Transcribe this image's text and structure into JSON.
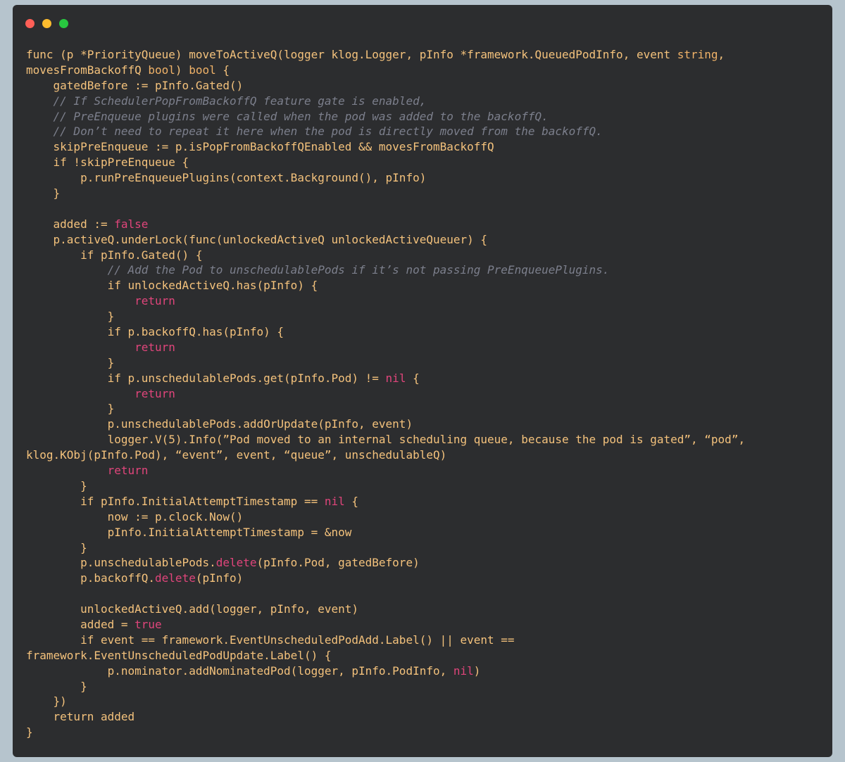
{
  "window": {
    "controls": [
      {
        "name": "close",
        "color": "#ff5f57"
      },
      {
        "name": "minimize",
        "color": "#febc2e"
      },
      {
        "name": "zoom",
        "color": "#28c840"
      }
    ]
  },
  "colors": {
    "page_background": "#b6c4cd",
    "editor_background": "#2c2d2f",
    "default": "#f4c27c",
    "literal": "#e0457b",
    "comment": "#7c7f8c",
    "punctuation": "#e8e8e8"
  },
  "code": {
    "lines": [
      [
        [
          "default",
          "func (p *PriorityQueue) moveToActiveQ(logger klog.Logger, pInfo *framework.QueuedPodInfo, event "
        ],
        [
          "type",
          "string"
        ],
        [
          "default",
          ","
        ]
      ],
      [
        [
          "default",
          "movesFromBackoffQ "
        ],
        [
          "type",
          "bool"
        ],
        [
          "default",
          ") "
        ],
        [
          "type",
          "bool"
        ],
        [
          "default",
          " {"
        ]
      ],
      [
        [
          "default",
          "    gatedBefore := pInfo.Gated()"
        ]
      ],
      [
        [
          "comment",
          "    // If SchedulerPopFromBackoffQ feature gate is enabled,"
        ]
      ],
      [
        [
          "comment",
          "    // PreEnqueue plugins were called when the pod was added to the backoffQ."
        ]
      ],
      [
        [
          "comment",
          "    // Don’t need to repeat it here when the pod is directly moved from the backoffQ."
        ]
      ],
      [
        [
          "default",
          "    skipPreEnqueue := p.isPopFromBackoffQEnabled && movesFromBackoffQ"
        ]
      ],
      [
        [
          "default",
          "    if !skipPreEnqueue {"
        ]
      ],
      [
        [
          "default",
          "        p.runPreEnqueuePlugins(context.Background(), pInfo)"
        ]
      ],
      [
        [
          "default",
          "    }"
        ]
      ],
      [
        [
          "default",
          ""
        ]
      ],
      [
        [
          "default",
          "    added := "
        ],
        [
          "literal",
          "false"
        ]
      ],
      [
        [
          "default",
          "    p.activeQ.underLock(func(unlockedActiveQ unlockedActiveQueuer) {"
        ]
      ],
      [
        [
          "default",
          "        if pInfo.Gated() {"
        ]
      ],
      [
        [
          "comment",
          "            // Add the Pod to unschedulablePods if it’s not passing PreEnqueuePlugins."
        ]
      ],
      [
        [
          "default",
          "            if unlockedActiveQ.has(pInfo) {"
        ]
      ],
      [
        [
          "literal",
          "                return"
        ]
      ],
      [
        [
          "default",
          "            }"
        ]
      ],
      [
        [
          "default",
          "            if p.backoffQ.has(pInfo) {"
        ]
      ],
      [
        [
          "literal",
          "                return"
        ]
      ],
      [
        [
          "default",
          "            }"
        ]
      ],
      [
        [
          "default",
          "            if p.unschedulablePods.get(pInfo.Pod) != "
        ],
        [
          "literal",
          "nil"
        ],
        [
          "default",
          " {"
        ]
      ],
      [
        [
          "literal",
          "                return"
        ]
      ],
      [
        [
          "default",
          "            }"
        ]
      ],
      [
        [
          "default",
          "            p.unschedulablePods.addOrUpdate(pInfo, event)"
        ]
      ],
      [
        [
          "default",
          "            logger.V(5).Info(”Pod moved to an internal scheduling queue, because the pod is gated”, “pod”,"
        ]
      ],
      [
        [
          "default",
          "klog.KObj(pInfo.Pod), “event”, event, “queue”, unschedulableQ)"
        ]
      ],
      [
        [
          "literal",
          "            return"
        ]
      ],
      [
        [
          "default",
          "        }"
        ]
      ],
      [
        [
          "default",
          "        if pInfo.InitialAttemptTimestamp == "
        ],
        [
          "literal",
          "nil"
        ],
        [
          "default",
          " {"
        ]
      ],
      [
        [
          "default",
          "            now := p.clock.Now()"
        ]
      ],
      [
        [
          "default",
          "            pInfo.InitialAttemptTimestamp = &now"
        ]
      ],
      [
        [
          "default",
          "        }"
        ]
      ],
      [
        [
          "default",
          "        p.unschedulablePods."
        ],
        [
          "literal",
          "delete"
        ],
        [
          "default",
          "(pInfo.Pod, gatedBefore)"
        ]
      ],
      [
        [
          "default",
          "        p.backoffQ."
        ],
        [
          "literal",
          "delete"
        ],
        [
          "default",
          "(pInfo)"
        ]
      ],
      [
        [
          "default",
          ""
        ]
      ],
      [
        [
          "default",
          "        unlockedActiveQ.add(logger, pInfo, event)"
        ]
      ],
      [
        [
          "default",
          "        added = "
        ],
        [
          "literal",
          "true"
        ]
      ],
      [
        [
          "default",
          "        if event == framework.EventUnscheduledPodAdd.Label() || event =="
        ]
      ],
      [
        [
          "default",
          "framework.EventUnscheduledPodUpdate.Label() {"
        ]
      ],
      [
        [
          "default",
          "            p.nominator.addNominatedPod(logger, pInfo.PodInfo, "
        ],
        [
          "literal",
          "nil"
        ],
        [
          "default",
          ")"
        ]
      ],
      [
        [
          "default",
          "        }"
        ]
      ],
      [
        [
          "default",
          "    })"
        ]
      ],
      [
        [
          "default",
          "    return added"
        ]
      ],
      [
        [
          "default",
          "}"
        ]
      ]
    ]
  }
}
